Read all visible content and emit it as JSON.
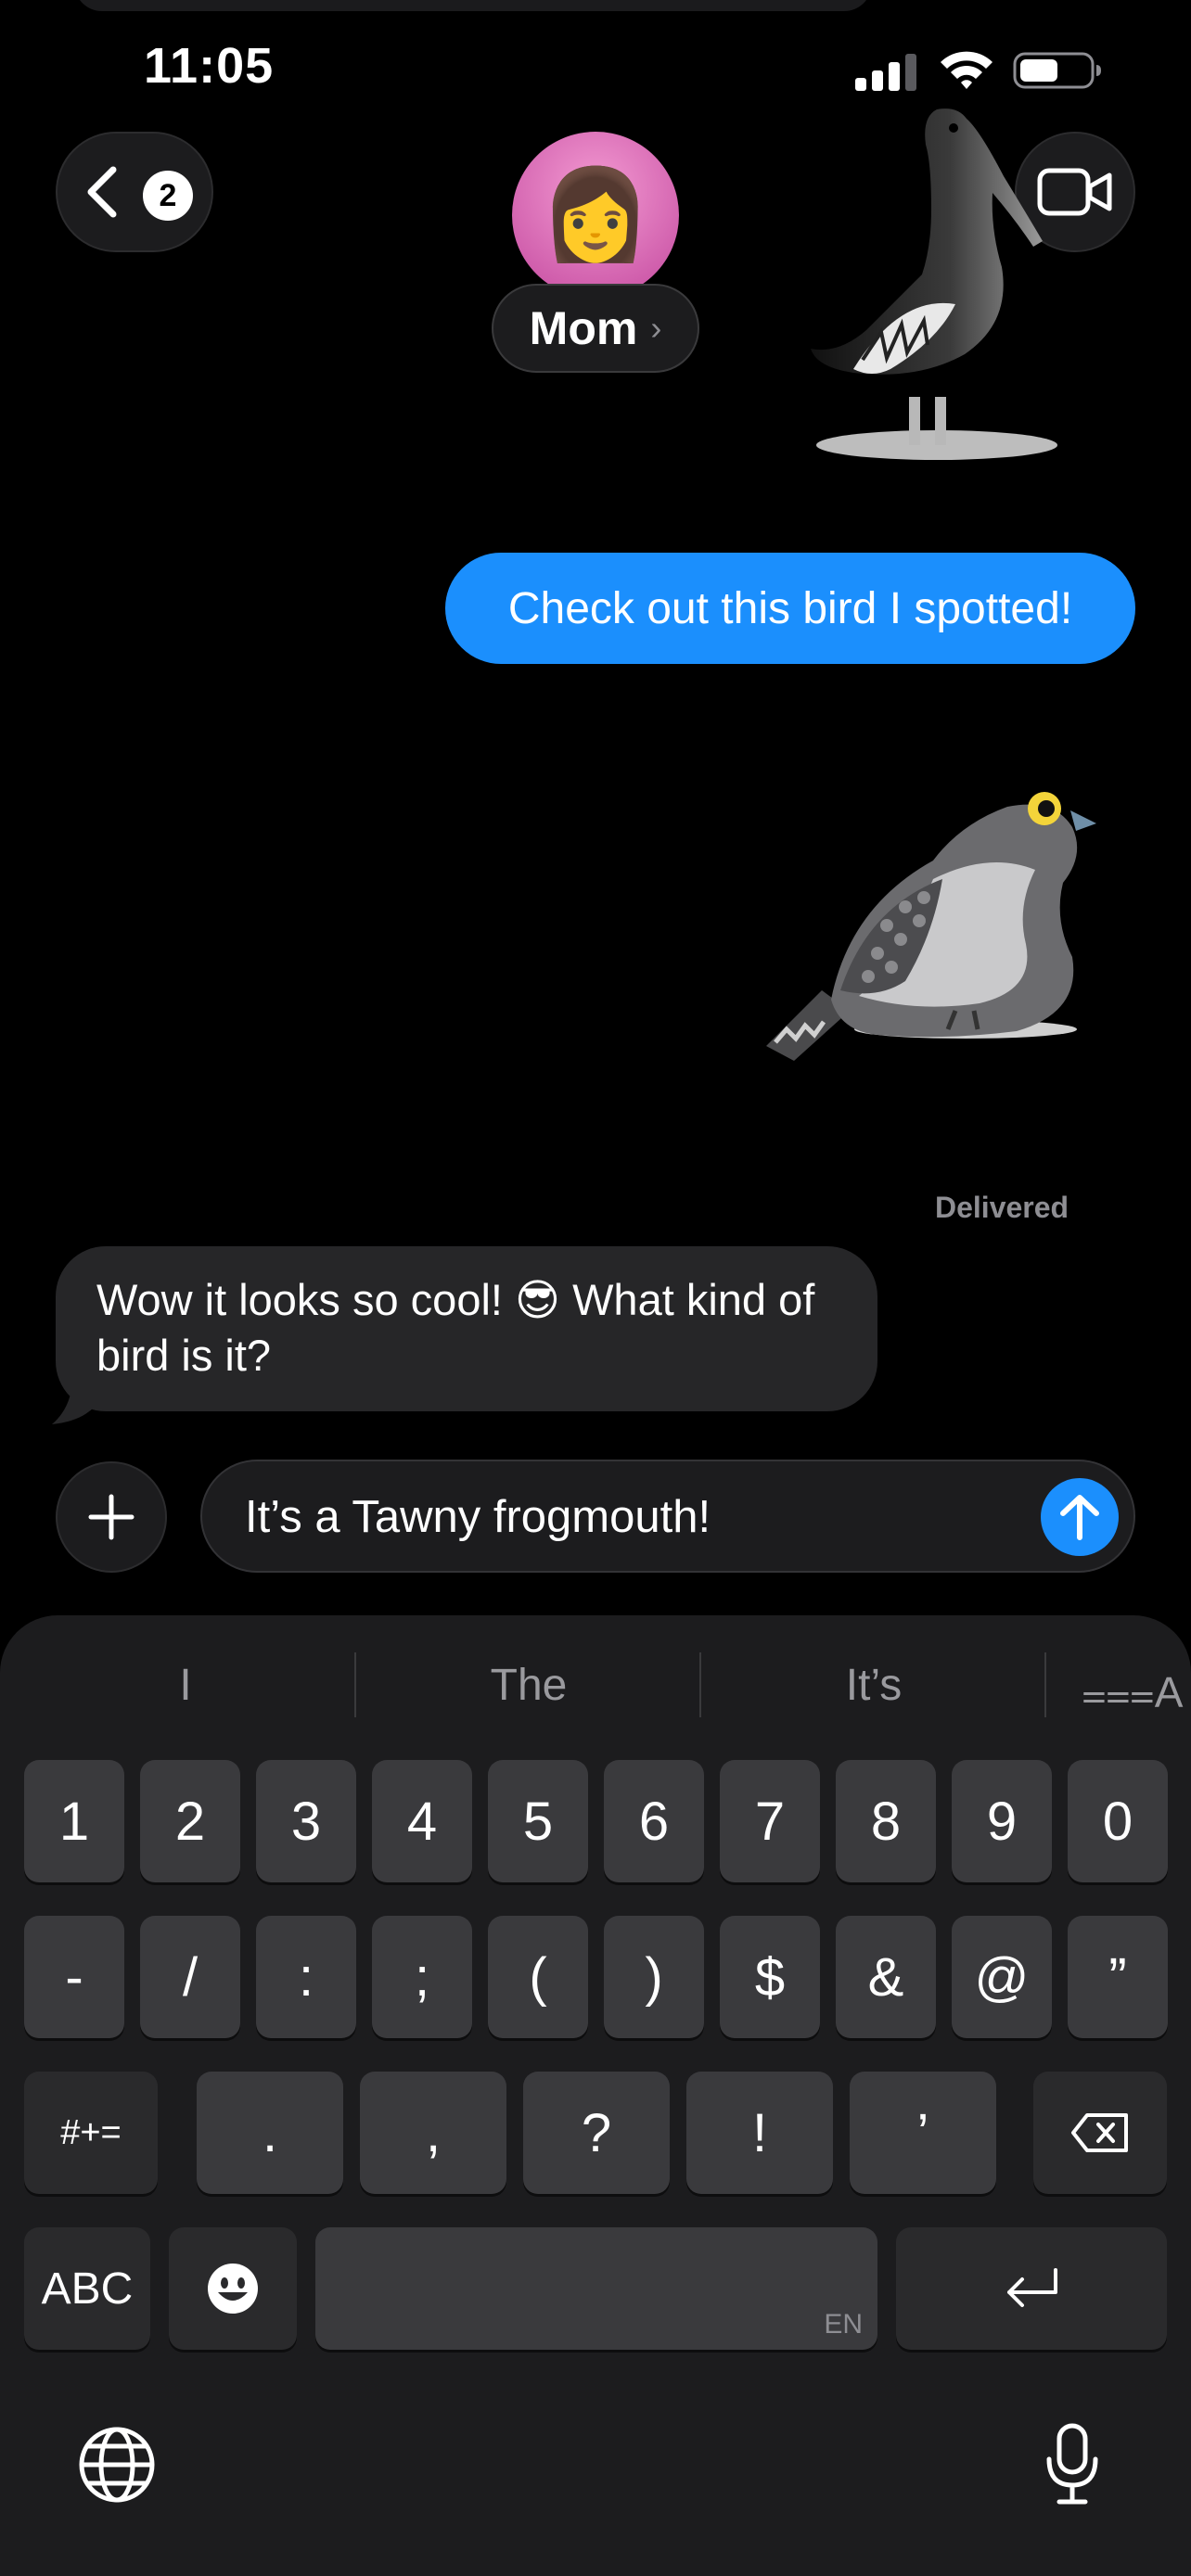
{
  "status_bar": {
    "time": "11:05"
  },
  "header": {
    "back_badge": "2",
    "contact_name": "Mom",
    "contact_chevron": "›",
    "avatar_emoji": "👩"
  },
  "messages": {
    "outgoing_1": "Check out this bird I spotted!",
    "delivered": "Delivered",
    "incoming_1": "Wow it looks so cool! 😎 What kind of bird is it?"
  },
  "input": {
    "value": "It’s a Tawny frogmouth!"
  },
  "keyboard": {
    "predictions": [
      "I",
      "The",
      "It’s"
    ],
    "format_label": "⩶A",
    "row1": [
      "1",
      "2",
      "3",
      "4",
      "5",
      "6",
      "7",
      "8",
      "9",
      "0"
    ],
    "row2": [
      "-",
      "/",
      ":",
      ";",
      "(",
      ")",
      "$",
      "&",
      "@",
      "”"
    ],
    "row3": [
      ".",
      ",",
      "?",
      "!",
      "’"
    ],
    "symbols_toggle": "#+=",
    "abc_label": "ABC",
    "space_language": "EN",
    "emoji_label": "☻"
  },
  "colors": {
    "accent_blue": "#1b8ffd",
    "incoming_bubble": "#262628",
    "keyboard_bg": "#1c1c1e",
    "key_bg": "#3a3a3d"
  }
}
